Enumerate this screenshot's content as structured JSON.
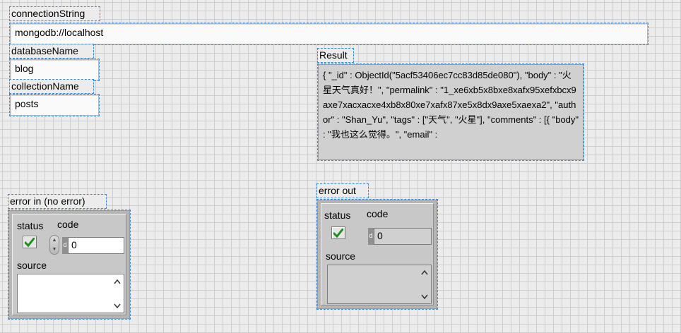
{
  "connection": {
    "label": "connectionString",
    "value": "mongodb://localhost"
  },
  "database": {
    "label": "databaseName",
    "value": "blog"
  },
  "collection": {
    "label": "collectionName",
    "value": "posts"
  },
  "result": {
    "label": "Result",
    "text": "{ \"_id\" : ObjectId(\"5acf53406ec7cc83d85de080\"), \"body\" : \"火星天气真好！\", \"permalink\" : \"1_xe6xb5x8bxe8xafx95xefxbcx9axe7xacxacxe4xb8x80xe7xafx87xe5x8dx9axe5xaexa2\", \"author\" : \"Shan_Yu\", \"tags\" : [\"天气\", \"火星\"], \"comments\" : [{ \"body\" : \"我也这么觉得。\", \"email\" :"
  },
  "error_in": {
    "label": "error in (no error)",
    "status_label": "status",
    "code_label": "code",
    "code_value": "0",
    "source_label": "source",
    "source_value": "",
    "dtag": "d"
  },
  "error_out": {
    "label": "error out",
    "status_label": "status",
    "code_label": "code",
    "code_value": "0",
    "source_label": "source",
    "source_value": "",
    "dtag": "d"
  },
  "icons": {
    "check": "green-check-icon",
    "scroll_up": "▲",
    "scroll_down": "▼"
  },
  "colors": {
    "selection": "#3a8ad6",
    "check_green": "#2aa52a"
  }
}
